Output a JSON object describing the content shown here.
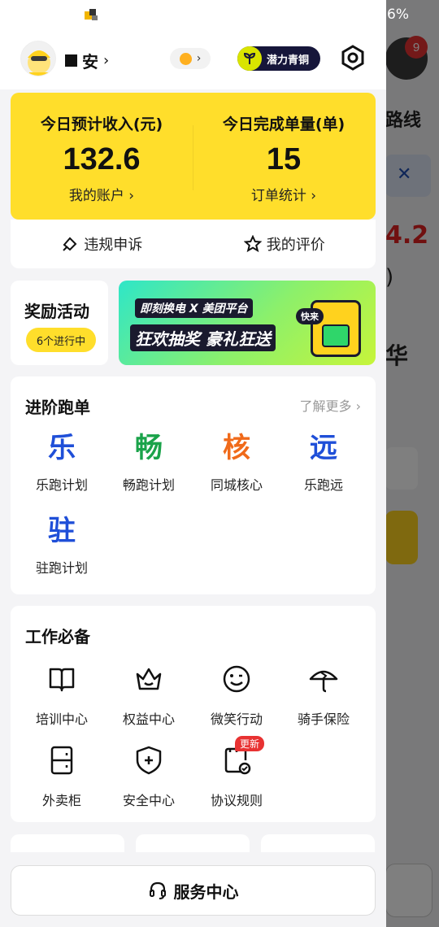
{
  "status_bar": {
    "battery_pct": "6%"
  },
  "profile": {
    "name": "安",
    "name_chevron": "›",
    "tier": "潜力青铜"
  },
  "income": {
    "left": {
      "label": "今日预计收入(元)",
      "value": "132.6",
      "link": "我的账户 ›"
    },
    "right": {
      "label": "今日完成单量(单)",
      "value": "15",
      "link": "订单统计 ›"
    }
  },
  "actions": {
    "appeal": "违规申诉",
    "rating": "我的评价"
  },
  "reward": {
    "title": "奖励活动",
    "pill": "6个进行中",
    "banner": {
      "line1": "即刻换电 X 美团平台",
      "line2": "狂欢抽奖 豪礼狂送",
      "badge": "快来"
    }
  },
  "advanced": {
    "title": "进阶跑单",
    "more": "了解更多 ›",
    "items": [
      {
        "glyph": "乐",
        "label": "乐跑计划",
        "color": "#1f4fd8"
      },
      {
        "glyph": "畅",
        "label": "畅跑计划",
        "color": "#1aa34a"
      },
      {
        "glyph": "核",
        "label": "同城核心",
        "color": "#f06a1a"
      },
      {
        "glyph": "远",
        "label": "乐跑远",
        "color": "#1f4fd8"
      },
      {
        "glyph": "驻",
        "label": "驻跑计划",
        "color": "#1f4fd8"
      }
    ]
  },
  "essentials": {
    "title": "工作必备",
    "items": [
      {
        "label": "培训中心",
        "icon": "book-icon"
      },
      {
        "label": "权益中心",
        "icon": "crown-icon"
      },
      {
        "label": "微笑行动",
        "icon": "smile-icon"
      },
      {
        "label": "骑手保险",
        "icon": "umbrella-icon"
      },
      {
        "label": "外卖柜",
        "icon": "locker-icon"
      },
      {
        "label": "安全中心",
        "icon": "shield-icon"
      },
      {
        "label": "协议规则",
        "icon": "agreement-icon"
      }
    ],
    "new_badge": "更新"
  },
  "service": {
    "label": "服务中心"
  },
  "background": {
    "badge_count": "9",
    "route_text": "路线",
    "amount_fragment": "4.2",
    "paren": ")",
    "name_fragment": "华"
  },
  "colors": {
    "accent_yellow": "#ffde2b",
    "dim_overlay": "rgba(0,0,0,0.5)"
  }
}
